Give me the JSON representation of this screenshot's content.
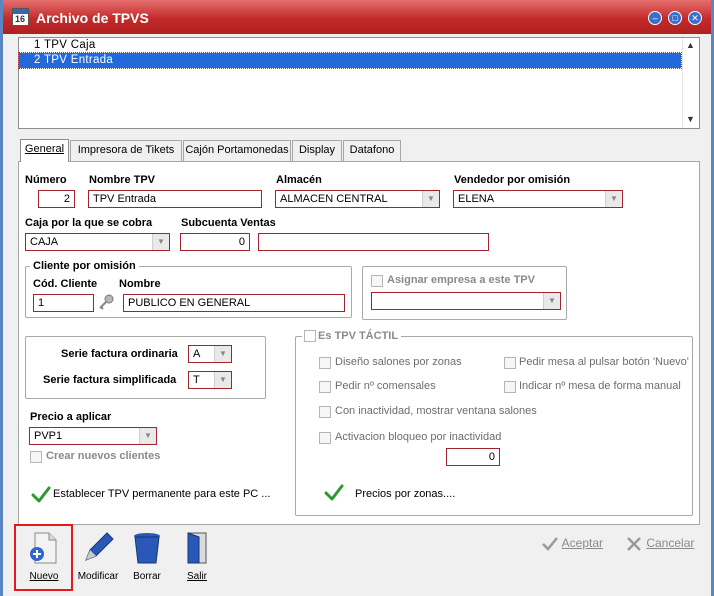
{
  "window": {
    "title": "Archivo de TPVS",
    "icon_label": "16",
    "minimize_icon": "minimize-icon",
    "maximize_icon": "maximize-icon",
    "close_icon": "close-icon"
  },
  "list": {
    "items": [
      "1 TPV Caja",
      "2 TPV Entrada"
    ],
    "selected_index": 1
  },
  "tabs": [
    {
      "label": "General",
      "active": true
    },
    {
      "label": "Impresora de Tikets",
      "active": false
    },
    {
      "label": "Cajón Portamonedas",
      "active": false
    },
    {
      "label": "Display",
      "active": false
    },
    {
      "label": "Datafono",
      "active": false
    }
  ],
  "general": {
    "numero_label": "Número",
    "numero_value": "2",
    "nombre_label": "Nombre TPV",
    "nombre_value": "TPV Entrada",
    "almacen_label": "Almacén",
    "almacen_value": "ALMACEN CENTRAL",
    "vendedor_label": "Vendedor por omisión",
    "vendedor_value": "ELENA",
    "caja_label": "Caja por la que se cobra",
    "caja_value": "CAJA",
    "subcuenta_label": "Subcuenta Ventas",
    "subcuenta_value": "0",
    "subcuenta_desc_value": "",
    "cliente_group": "Cliente por omisión",
    "cod_cliente_label": "Cód. Cliente",
    "cod_cliente_value": "1",
    "cliente_nombre_label": "Nombre",
    "cliente_nombre_value": "PUBLICO EN GENERAL",
    "asignar_empresa_label": "Asignar empresa a este TPV",
    "asignar_empresa_value": "",
    "serie_ordinaria_label": "Serie factura ordinaria",
    "serie_ordinaria_value": "A",
    "serie_simplificada_label": "Serie factura simplificada",
    "serie_simplificada_value": "T",
    "precio_label": "Precio a aplicar",
    "precio_value": "PVP1",
    "crear_clientes_label": "Crear nuevos clientes",
    "establecer_label": "Establecer TPV permanente para este PC ...",
    "tactil_group": "Es TPV TÁCTIL",
    "diseno_label": "Diseño salones por zonas",
    "pedir_mesa_label": "Pedir mesa al pulsar botón 'Nuevo'",
    "pedir_comensales_label": "Pedir nº comensales",
    "indicar_mesa_label": "Indicar nº mesa  de forma manual",
    "inactividad_label": "Con inactividad, mostrar ventana salones",
    "bloqueo_label": "Activacion bloqueo por inactividad",
    "bloqueo_value": "0",
    "precios_zonas_label": "Precios por zonas...."
  },
  "toolbar": {
    "nuevo": "Nuevo",
    "modificar": "Modificar",
    "borrar": "Borrar",
    "salir": "Salir",
    "aceptar": "Aceptar",
    "cancelar": "Cancelar"
  },
  "colors": {
    "title_bar": "#c22b2a",
    "field_border": "#a3222b",
    "selection": "#2369d9",
    "check_green": "#2e9a2e",
    "highlight": "#e01b1b"
  }
}
